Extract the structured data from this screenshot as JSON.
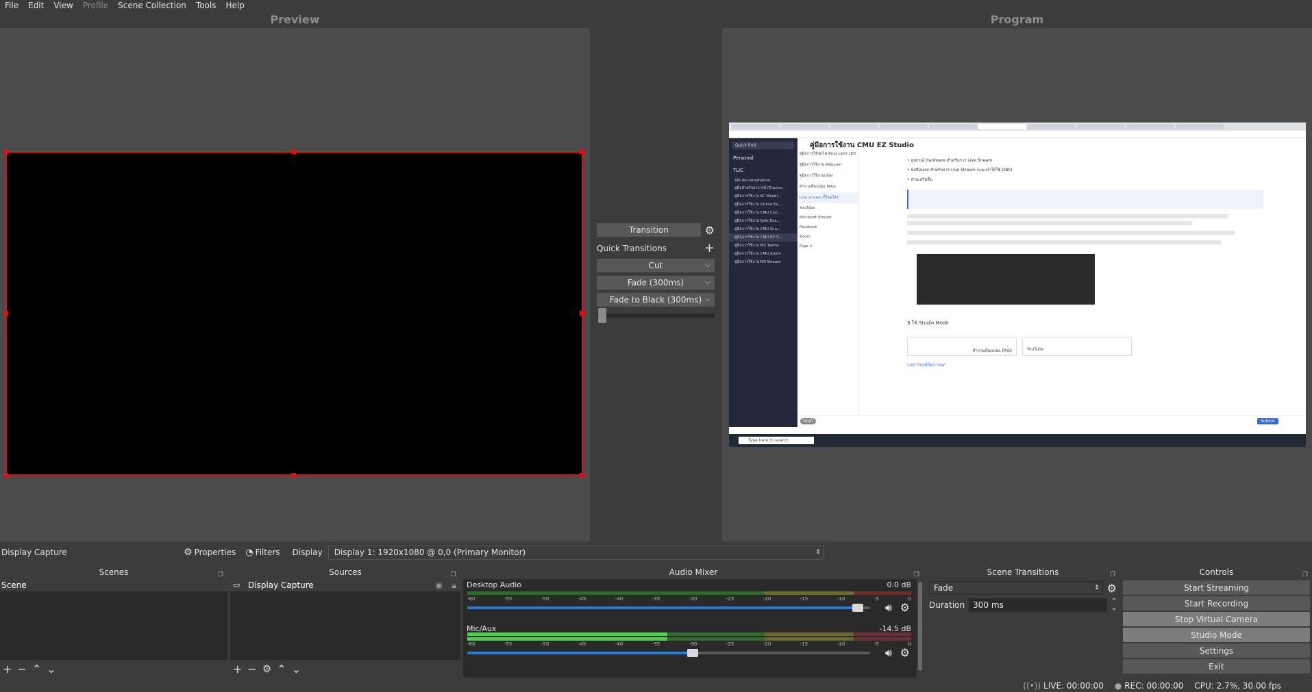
{
  "menu": [
    "File",
    "Edit",
    "View",
    "Profile",
    "Scene Collection",
    "Tools",
    "Help"
  ],
  "preview_title": "Preview",
  "program_title": "Program",
  "transition": {
    "button": "Transition",
    "quick_label": "Quick Transitions",
    "options": [
      "Cut",
      "Fade (300ms)",
      "Fade to Black (300ms)"
    ]
  },
  "source_bar": {
    "source_name": "Display Capture",
    "properties": "Properties",
    "filters": "Filters",
    "display_label": "Display",
    "display_value": "Display 1: 1920x1080 @ 0,0 (Primary Monitor)"
  },
  "scenes": {
    "title": "Scenes",
    "items": [
      "Scene"
    ]
  },
  "sources": {
    "title": "Sources",
    "items": [
      "Display Capture"
    ]
  },
  "mixer": {
    "title": "Audio Mixer",
    "ticks": [
      "-60",
      "-55",
      "-50",
      "-45",
      "-40",
      "-35",
      "-30",
      "-25",
      "-20",
      "-15",
      "-10",
      "-5",
      "0"
    ],
    "channels": [
      {
        "name": "Desktop Audio",
        "db": "0.0 dB",
        "level": 0.0,
        "volume": 0.97
      },
      {
        "name": "Mic/Aux",
        "db": "-14.5 dB",
        "level": 0.45,
        "volume": 0.56
      }
    ]
  },
  "scene_transitions": {
    "title": "Scene Transitions",
    "selected": "Fade",
    "duration_label": "Duration",
    "duration_value": "300 ms"
  },
  "controls": {
    "title": "Controls",
    "buttons": [
      "Start Streaming",
      "Start Recording",
      "Stop Virtual Camera",
      "Studio Mode",
      "Settings",
      "Exit"
    ]
  },
  "status": {
    "live": "LIVE: 00:00:00",
    "rec": "REC: 00:00:00",
    "cpu": "CPU: 2.7%, 30.00 fps"
  },
  "program_content": {
    "page_title": "คู่มือการใช้งาน CMU EZ Studio",
    "search": "Quick find",
    "workspace": "Personal",
    "team": "TLIC",
    "sidebar_items": [
      "API-documentation",
      "คู่มือสำหรับอาจารย์ (Teache...",
      "คู่มือการใช้งาน KC Moodl...",
      "คู่มือการใช้งาน Online Ex...",
      "คู่มือการใช้งาน CMU Can...",
      "คู่มือการใช้งาน Safe Exa...",
      "คู่มือการใช้งาน CMU Gra...",
      "คู่มือการใช้งาน CMU EZ S...",
      "คู่มือการใช้งาน MS Teams",
      "คู่มือการใช้งาน CMU Zoom",
      "คู่มือการใช้งาน MS Stream"
    ],
    "nav_items": [
      "คู่มือการใช้ชุดไฟ Ring Light LED",
      "คู่มือการใช้งาน Webcam",
      "คู่มือการใช้งานกล้อง",
      "คำถามที่พบบ่อย FAQs",
      "Live stream ที่ไหนได้?",
      "YouTube",
      "Microsoft Stream",
      "Facebook",
      "Zoom",
      "Page 1"
    ],
    "bullets": [
      "อุปกรณ์ Hardware สำหรับการ Live Stream",
      "Software สำหรับการ Live Stream (แนะนำให้ใช้ OBS)",
      "ส่วนเสริมอื่น"
    ],
    "step": "3.ใช้ Studio Mode",
    "prev_label": "คำถามที่พบบ่อย FAQs",
    "next_label": "YouTube",
    "modified": "Last modified now",
    "draft": "Draft",
    "submit": "Submit",
    "taskbar_search": "Type here to search"
  },
  "colors": {
    "accent_red": "#e01010",
    "blue": "#2b7bd6",
    "panel": "#3c3c3c",
    "dock_bg": "#2a2a2a"
  }
}
